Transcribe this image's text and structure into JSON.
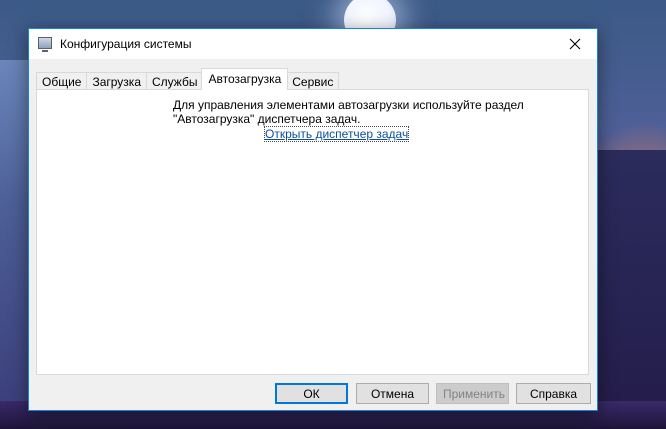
{
  "window": {
    "title": "Конфигурация системы"
  },
  "tabs": [
    {
      "label": "Общие",
      "active": false
    },
    {
      "label": "Загрузка",
      "active": false
    },
    {
      "label": "Службы",
      "active": false
    },
    {
      "label": "Автозагрузка",
      "active": true
    },
    {
      "label": "Сервис",
      "active": false
    }
  ],
  "startup_panel": {
    "info_line1": "Для управления элементами автозагрузки используйте раздел",
    "info_line2": "\"Автозагрузка\" диспетчера задач.",
    "link": "Открыть диспетчер задач"
  },
  "buttons": {
    "ok": "ОК",
    "cancel": "Отмена",
    "apply": "Применить",
    "help": "Справка"
  },
  "colors": {
    "accent": "#0078d7",
    "link": "#0b4f9a",
    "window_border": "#1883d7"
  },
  "icons": {
    "app": "system-config-icon",
    "close": "close-icon"
  }
}
